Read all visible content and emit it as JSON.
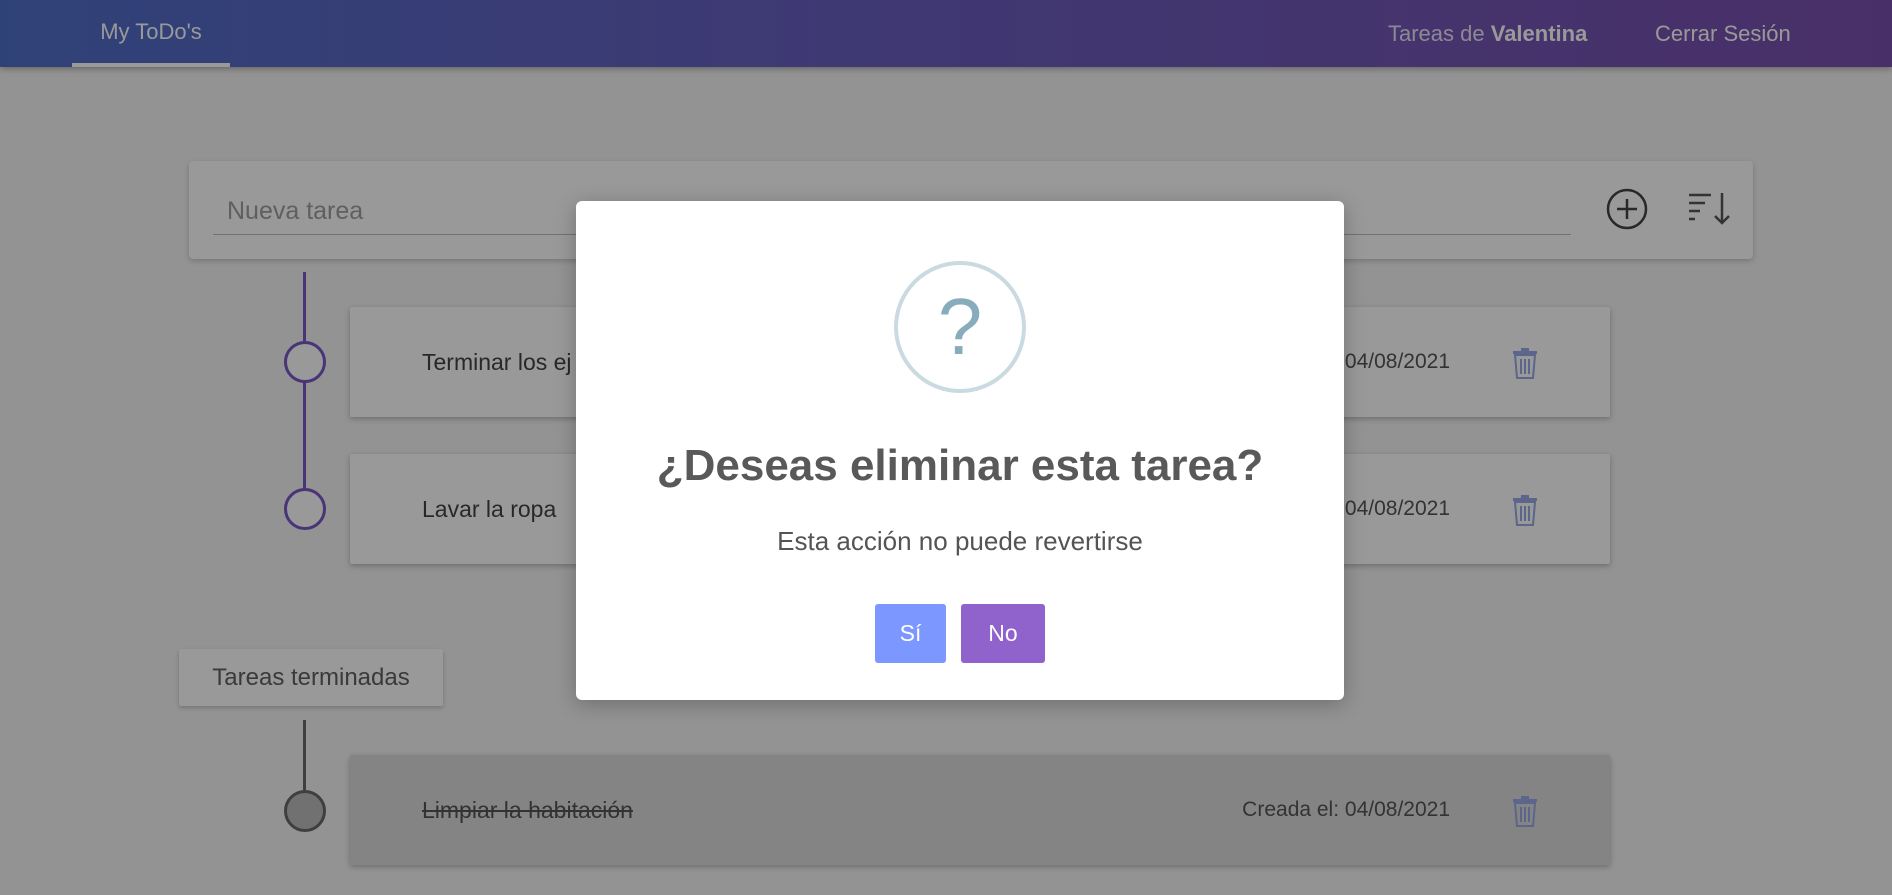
{
  "navbar": {
    "brand": "My ToDo's",
    "user_prefix": "Tareas de ",
    "user_name": "Valentina",
    "logout": "Cerrar Sesión"
  },
  "new_task": {
    "placeholder": "Nueva tarea",
    "add_icon": "plus-circle-icon",
    "sort_icon": "sort-descending-icon"
  },
  "pending_tasks": [
    {
      "text": "Terminar los ej",
      "date": "04/08/2021"
    },
    {
      "text": "Lavar la ropa",
      "date": "04/08/2021"
    }
  ],
  "completed_section": {
    "label": "Tareas terminadas",
    "tasks": [
      {
        "text": "Limpiar la habitación",
        "date": "Creada el: 04/08/2021"
      }
    ]
  },
  "modal": {
    "icon": "?",
    "title": "¿Deseas eliminar esta tarea?",
    "text": "Esta acción no puede revertirse",
    "confirm": "Sí",
    "cancel": "No"
  },
  "colors": {
    "accent_purple": "#7b57c8",
    "confirm_blue": "#7c97ff",
    "cancel_purple": "#8f62cc",
    "question_icon": "#87adbd"
  }
}
